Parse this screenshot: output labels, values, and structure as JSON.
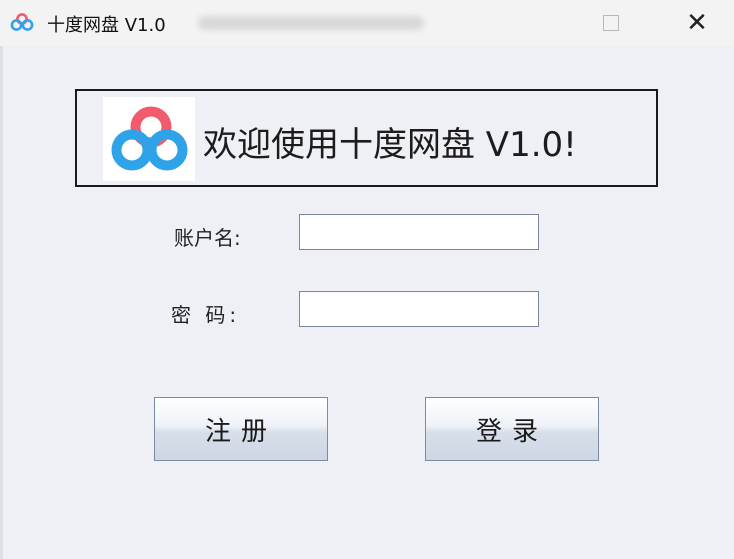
{
  "window": {
    "title": "十度网盘  V1.0",
    "icon": "cloud-logo-icon",
    "controls": {
      "minimize_icon": "minimize-icon",
      "maximize_icon": "maximize-icon",
      "close_glyph": "✕"
    }
  },
  "banner": {
    "logo_icon": "cloud-logo-icon",
    "text": "欢迎使用十度网盘 V1.0!"
  },
  "form": {
    "username_label": "账户名:",
    "username_value": "",
    "password_label": "密  码:",
    "password_value": ""
  },
  "buttons": {
    "register": "注册",
    "login": "登录"
  },
  "colors": {
    "logo_blue": "#2fa3e8",
    "logo_red": "#f25a6d",
    "window_bg": "#eef0f5"
  }
}
